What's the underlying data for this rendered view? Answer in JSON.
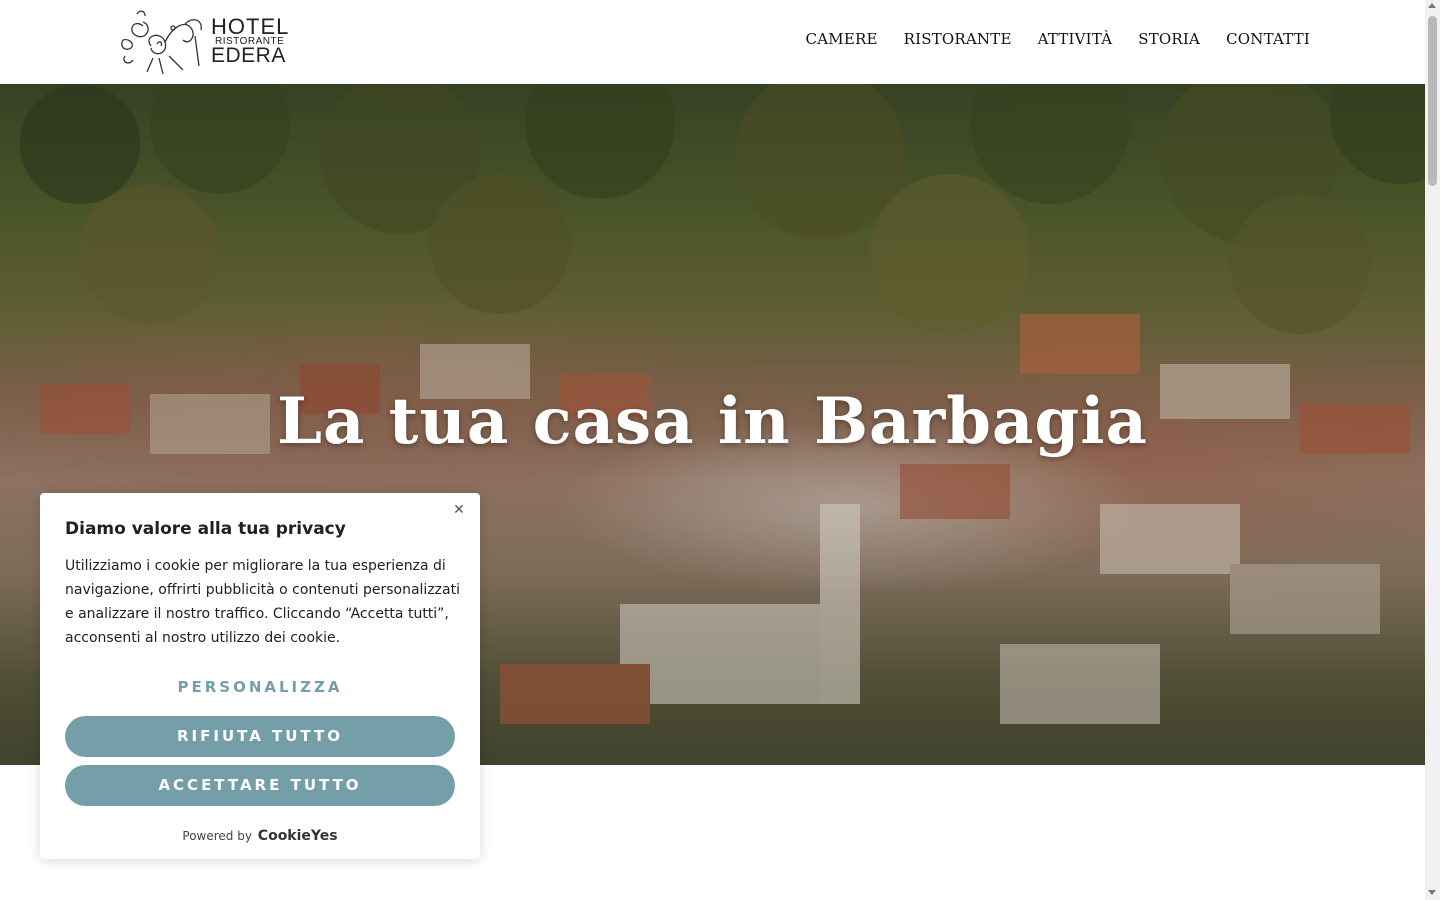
{
  "header": {
    "logo": {
      "hotel": "HOTEL",
      "ristorante": "RISTORANTE",
      "edera": "EDERA"
    },
    "nav": [
      "CAMERE",
      "RISTORANTE",
      "ATTIVITÀ",
      "STORIA",
      "CONTATTI"
    ]
  },
  "hero": {
    "title": "La tua casa in Barbagia"
  },
  "cookie_banner": {
    "close_icon": "close-icon",
    "title": "Diamo valore alla tua privacy",
    "text": "Utilizziamo i cookie per migliorare la tua esperienza di navigazione, offrirti pubblicità o contenuti personalizzati e analizzare il nostro traffico. Cliccando “Accetta tutti”, acconsenti al nostro utilizzo dei cookie.",
    "customize_label": "PERSONALIZZA",
    "reject_label": "RIFIUTA TUTTO",
    "accept_label": "ACCETTARE TUTTO",
    "powered_by": "Powered by",
    "brand": "CookieYes",
    "accent_color": "#759fa8"
  }
}
